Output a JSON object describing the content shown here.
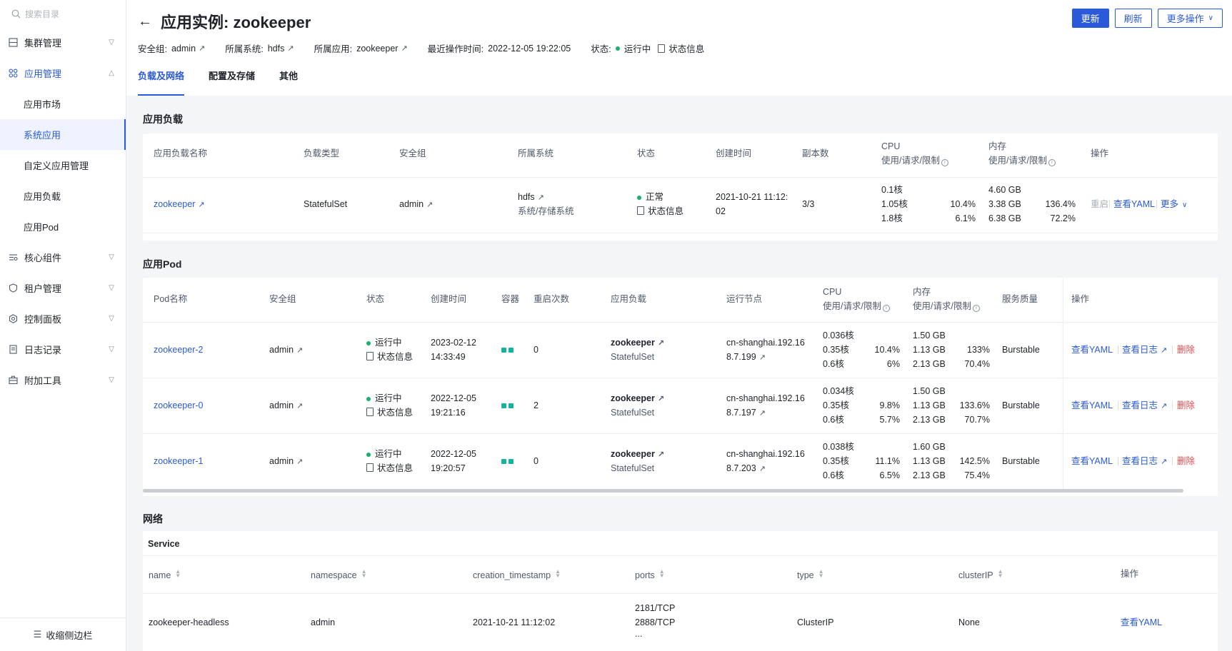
{
  "sidebar": {
    "search_placeholder": "搜索目录",
    "groups": [
      {
        "label": "集群管理"
      },
      {
        "label": "应用管理"
      },
      {
        "label": "核心组件"
      },
      {
        "label": "租户管理"
      },
      {
        "label": "控制面板"
      },
      {
        "label": "日志记录"
      },
      {
        "label": "附加工具"
      }
    ],
    "sub_items": [
      {
        "label": "应用市场"
      },
      {
        "label": "系统应用"
      },
      {
        "label": "自定义应用管理"
      },
      {
        "label": "应用负载"
      },
      {
        "label": "应用Pod"
      }
    ],
    "collapse_label": "收缩侧边栏"
  },
  "header": {
    "title": "应用实例: zookeeper",
    "buttons": {
      "update": "更新",
      "refresh": "刷新",
      "more": "更多操作"
    },
    "meta": {
      "security_group_label": "安全组:",
      "security_group": "admin",
      "system_label": "所属系统:",
      "system": "hdfs",
      "app_label": "所属应用:",
      "app": "zookeeper",
      "last_op_label": "最近操作时间:",
      "last_op": "2022-12-05 19:22:05",
      "status_label": "状态:",
      "status": "运行中",
      "status_info": "状态信息"
    },
    "tabs": [
      "负载及网络",
      "配置及存储",
      "其他"
    ]
  },
  "workload": {
    "title": "应用负载",
    "headers": {
      "name": "应用负载名称",
      "type": "负载类型",
      "sg": "安全组",
      "system": "所属系统",
      "status": "状态",
      "created": "创建时间",
      "replicas": "副本数",
      "cpu": "CPU",
      "cpu_sub": "使用/请求/限制",
      "mem": "内存",
      "mem_sub": "使用/请求/限制",
      "ops": "操作"
    },
    "row": {
      "name": "zookeeper",
      "type": "StatefulSet",
      "sg": "admin",
      "system": "hdfs",
      "system_sub": "系统/存储系统",
      "status": "正常",
      "status_info": "状态信息",
      "created_1": "2021-10-21 11:12:",
      "created_2": "02",
      "replicas": "3/3",
      "cpu_use": "0.1核",
      "cpu_req": "1.05核",
      "cpu_req_pct": "10.4%",
      "cpu_lim": "1.8核",
      "cpu_lim_pct": "6.1%",
      "mem_use": "4.60 GB",
      "mem_req": "3.38 GB",
      "mem_req_pct": "136.4%",
      "mem_lim": "6.38 GB",
      "mem_lim_pct": "72.2%",
      "op_restart": "重启",
      "op_yaml": "查看YAML",
      "op_more": "更多"
    }
  },
  "pods": {
    "title": "应用Pod",
    "headers": {
      "name": "Pod名称",
      "sg": "安全组",
      "status": "状态",
      "created": "创建时间",
      "containers": "容器",
      "restarts": "重启次数",
      "workload": "应用负载",
      "node": "运行节点",
      "cpu": "CPU",
      "cpu_sub": "使用/请求/限制",
      "mem": "内存",
      "mem_sub": "使用/请求/限制",
      "qos": "服务质量",
      "ops": "操作"
    },
    "rows": [
      {
        "name": "zookeeper-2",
        "sg": "admin",
        "status": "运行中",
        "status_info": "状态信息",
        "created_1": "2023-02-12",
        "created_2": "14:33:49",
        "restarts": "0",
        "wl": "zookeeper",
        "wl_type": "StatefulSet",
        "node_1": "cn-shanghai.192.16",
        "node_2": "8.7.199",
        "cpu_use": "0.036核",
        "cpu_req": "0.35核",
        "cpu_req_pct": "10.4%",
        "cpu_lim": "0.6核",
        "cpu_lim_pct": "6%",
        "mem_use": "1.50 GB",
        "mem_req": "1.13 GB",
        "mem_req_pct": "133%",
        "mem_lim": "2.13 GB",
        "mem_lim_pct": "70.4%",
        "qos": "Burstable",
        "op_yaml": "查看YAML",
        "op_log": "查看日志",
        "op_del": "删除"
      },
      {
        "name": "zookeeper-0",
        "sg": "admin",
        "status": "运行中",
        "status_info": "状态信息",
        "created_1": "2022-12-05",
        "created_2": "19:21:16",
        "restarts": "2",
        "wl": "zookeeper",
        "wl_type": "StatefulSet",
        "node_1": "cn-shanghai.192.16",
        "node_2": "8.7.197",
        "cpu_use": "0.034核",
        "cpu_req": "0.35核",
        "cpu_req_pct": "9.8%",
        "cpu_lim": "0.6核",
        "cpu_lim_pct": "5.7%",
        "mem_use": "1.50 GB",
        "mem_req": "1.13 GB",
        "mem_req_pct": "133.6%",
        "mem_lim": "2.13 GB",
        "mem_lim_pct": "70.7%",
        "qos": "Burstable",
        "op_yaml": "查看YAML",
        "op_log": "查看日志",
        "op_del": "删除"
      },
      {
        "name": "zookeeper-1",
        "sg": "admin",
        "status": "运行中",
        "status_info": "状态信息",
        "created_1": "2022-12-05",
        "created_2": "19:20:57",
        "restarts": "0",
        "wl": "zookeeper",
        "wl_type": "StatefulSet",
        "node_1": "cn-shanghai.192.16",
        "node_2": "8.7.203",
        "cpu_use": "0.038核",
        "cpu_req": "0.35核",
        "cpu_req_pct": "11.1%",
        "cpu_lim": "0.6核",
        "cpu_lim_pct": "6.5%",
        "mem_use": "1.60 GB",
        "mem_req": "1.13 GB",
        "mem_req_pct": "142.5%",
        "mem_lim": "2.13 GB",
        "mem_lim_pct": "75.4%",
        "qos": "Burstable",
        "op_yaml": "查看YAML",
        "op_log": "查看日志",
        "op_del": "删除"
      }
    ]
  },
  "network": {
    "title": "网络",
    "service_label": "Service",
    "headers": {
      "name": "name",
      "namespace": "namespace",
      "ts": "creation_timestamp",
      "ports": "ports",
      "type": "type",
      "cluster_ip": "clusterIP",
      "ops": "操作"
    },
    "row": {
      "name": "zookeeper-headless",
      "namespace": "admin",
      "ts": "2021-10-21 11:12:02",
      "port_1": "2181/TCP",
      "port_2": "2888/TCP",
      "port_more": "...",
      "type": "ClusterIP",
      "cluster_ip": "None",
      "op_yaml": "查看YAML"
    }
  }
}
